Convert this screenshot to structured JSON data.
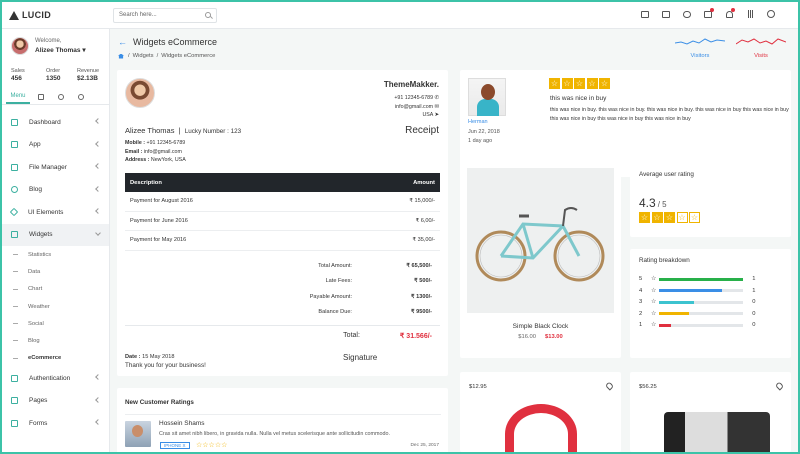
{
  "app": {
    "logo": "LUCID"
  },
  "search": {
    "placeholder": "Search here..."
  },
  "user": {
    "welcome": "Welcome,",
    "name": "Alizee Thomas ▾"
  },
  "stats": [
    {
      "label": "Sales",
      "value": "456"
    },
    {
      "label": "Order",
      "value": "1350"
    },
    {
      "label": "Revenue",
      "value": "$2.13B"
    }
  ],
  "sidebar_tabs": {
    "menu": "Menu"
  },
  "nav": [
    {
      "label": "Dashboard",
      "icon": "home-icon"
    },
    {
      "label": "App",
      "icon": "grid-icon"
    },
    {
      "label": "File Manager",
      "icon": "folder-icon"
    },
    {
      "label": "Blog",
      "icon": "globe-icon"
    },
    {
      "label": "UI Elements",
      "icon": "diamond-icon"
    },
    {
      "label": "Widgets",
      "icon": "tag-icon"
    }
  ],
  "widgets_sub": [
    "Statistics",
    "Data",
    "Chart",
    "Weather",
    "Social",
    "Blog",
    "eCommerce"
  ],
  "nav_bottom": [
    {
      "label": "Authentication",
      "icon": "lock-icon"
    },
    {
      "label": "Pages",
      "icon": "page-icon"
    },
    {
      "label": "Forms",
      "icon": "pencil-icon"
    }
  ],
  "page": {
    "title": "Widgets eCommerce",
    "crumb1": "Widgets",
    "crumb2": "Widgets eCommerce",
    "sep": "/"
  },
  "sparks": {
    "visitors": "Visitors",
    "visits": "Visits",
    "visitors_color": "#3a8ee6",
    "visits_color": "#e0303f"
  },
  "receipt": {
    "brand": "ThemeMakker.",
    "phone": "+91 12345-6789",
    "email": "info@gmail.com",
    "country": "USA",
    "customer": "Alizee Thomas",
    "lucky": "Lucky Number : 123",
    "heading": "Receipt",
    "mobile_label": "Mobile :",
    "mobile": " +91 12345-6789",
    "email_label": "Email :",
    "email2": " info@gmail.com",
    "address_label": "Address :",
    "address": " NewYork, USA",
    "col_desc": "Description",
    "col_amount": "Amount",
    "rows": [
      {
        "desc": "Payment for August 2016",
        "amount": "₹ 15,000/-"
      },
      {
        "desc": "Payment for June 2016",
        "amount": "₹ 6,00/-"
      },
      {
        "desc": "Payment for May 2016",
        "amount": "₹ 35,00/-"
      }
    ],
    "totals": [
      {
        "k": "Total Amount:",
        "v": "₹ 65,500/-"
      },
      {
        "k": "Late Fees:",
        "v": "₹ 500/-"
      },
      {
        "k": "Payable Amount:",
        "v": "₹ 1300/-"
      },
      {
        "k": "Balance Due:",
        "v": "₹ 9500/-"
      }
    ],
    "total_label": "Total:",
    "total_value": "₹ 31.566/-",
    "date_label": "Date :",
    "date": " 15 May 2018",
    "thanks": "Thank you for your business!",
    "signature": "Signature"
  },
  "ratings": {
    "title": "New Customer Ratings",
    "name": "Hossein Shams",
    "text": "Cras sit amet nibh libero, in gravida nulla. Nulla vel metus scelerisque ante sollicitudin commodo.",
    "badge": "IPHONE X",
    "stars": "☆☆☆☆☆",
    "date": "Dec 25, 2017"
  },
  "review": {
    "name": "Herman",
    "date": "Jun 22, 2018",
    "ago": "1 day ago",
    "title": "this was nice in buy",
    "body": "this was nice in buy. this was nice in buy. this was nice in buy. this was nice in buy this was nice in buy this was nice in buy this was nice in buy this was nice in buy",
    "star_glyph": "☆"
  },
  "product": {
    "title": "Simple Black Clock",
    "old": "$16.00",
    "new": "$13.00"
  },
  "avg": {
    "title": "Average user rating",
    "value": "4.3",
    "out": "/ 5"
  },
  "breakdown": {
    "title": "Rating breakdown",
    "rows": [
      {
        "label": "5",
        "fraction": 1,
        "count": "1",
        "color": "#28b04a"
      },
      {
        "label": "4",
        "fraction": 0.75,
        "count": "1",
        "color": "#3a8ee6"
      },
      {
        "label": "3",
        "fraction": 0.42,
        "count": "0",
        "color": "#3cc3cf"
      },
      {
        "label": "2",
        "fraction": 0.36,
        "count": "0",
        "color": "#f0b400"
      },
      {
        "label": "1",
        "fraction": 0.14,
        "count": "0",
        "color": "#e0303f"
      }
    ]
  },
  "products2": [
    {
      "price": "$12.95"
    },
    {
      "price": "$56.25"
    }
  ]
}
